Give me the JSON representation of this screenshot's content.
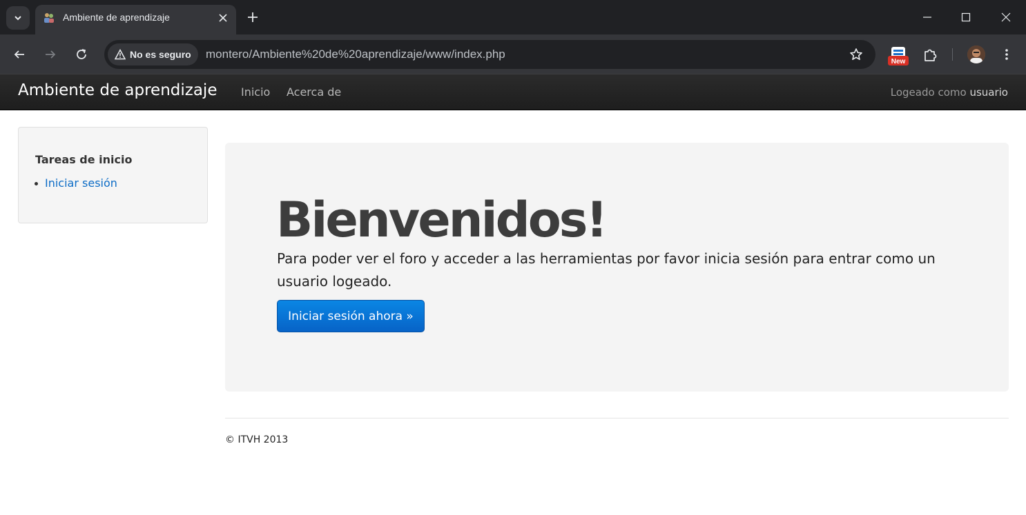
{
  "browser": {
    "tab_title": "Ambiente de aprendizaje",
    "security_label": "No es seguro",
    "url": "montero/Ambiente%20de%20aprendizaje/www/index.php",
    "extension_badge": "New"
  },
  "site": {
    "brand": "Ambiente de aprendizaje",
    "nav": {
      "home": "Inicio",
      "about": "Acerca de"
    },
    "login_prefix": "Logeado como",
    "login_user": "usuario"
  },
  "sidebar": {
    "title": "Tareas de inicio",
    "items": [
      {
        "label": "Iniciar sesión"
      }
    ]
  },
  "hero": {
    "title": "Bienvenidos!",
    "text": "Para poder ver el foro y acceder a las herramientas por favor inicia sesión para entrar como un usuario logeado.",
    "button_label": "Iniciar sesión ahora »"
  },
  "footer": {
    "text": "© ITVH 2013"
  },
  "colors": {
    "link": "#0c6cc6",
    "button": "#0874d6",
    "navbar": "#222222",
    "hero_bg": "#f4f4f4"
  }
}
